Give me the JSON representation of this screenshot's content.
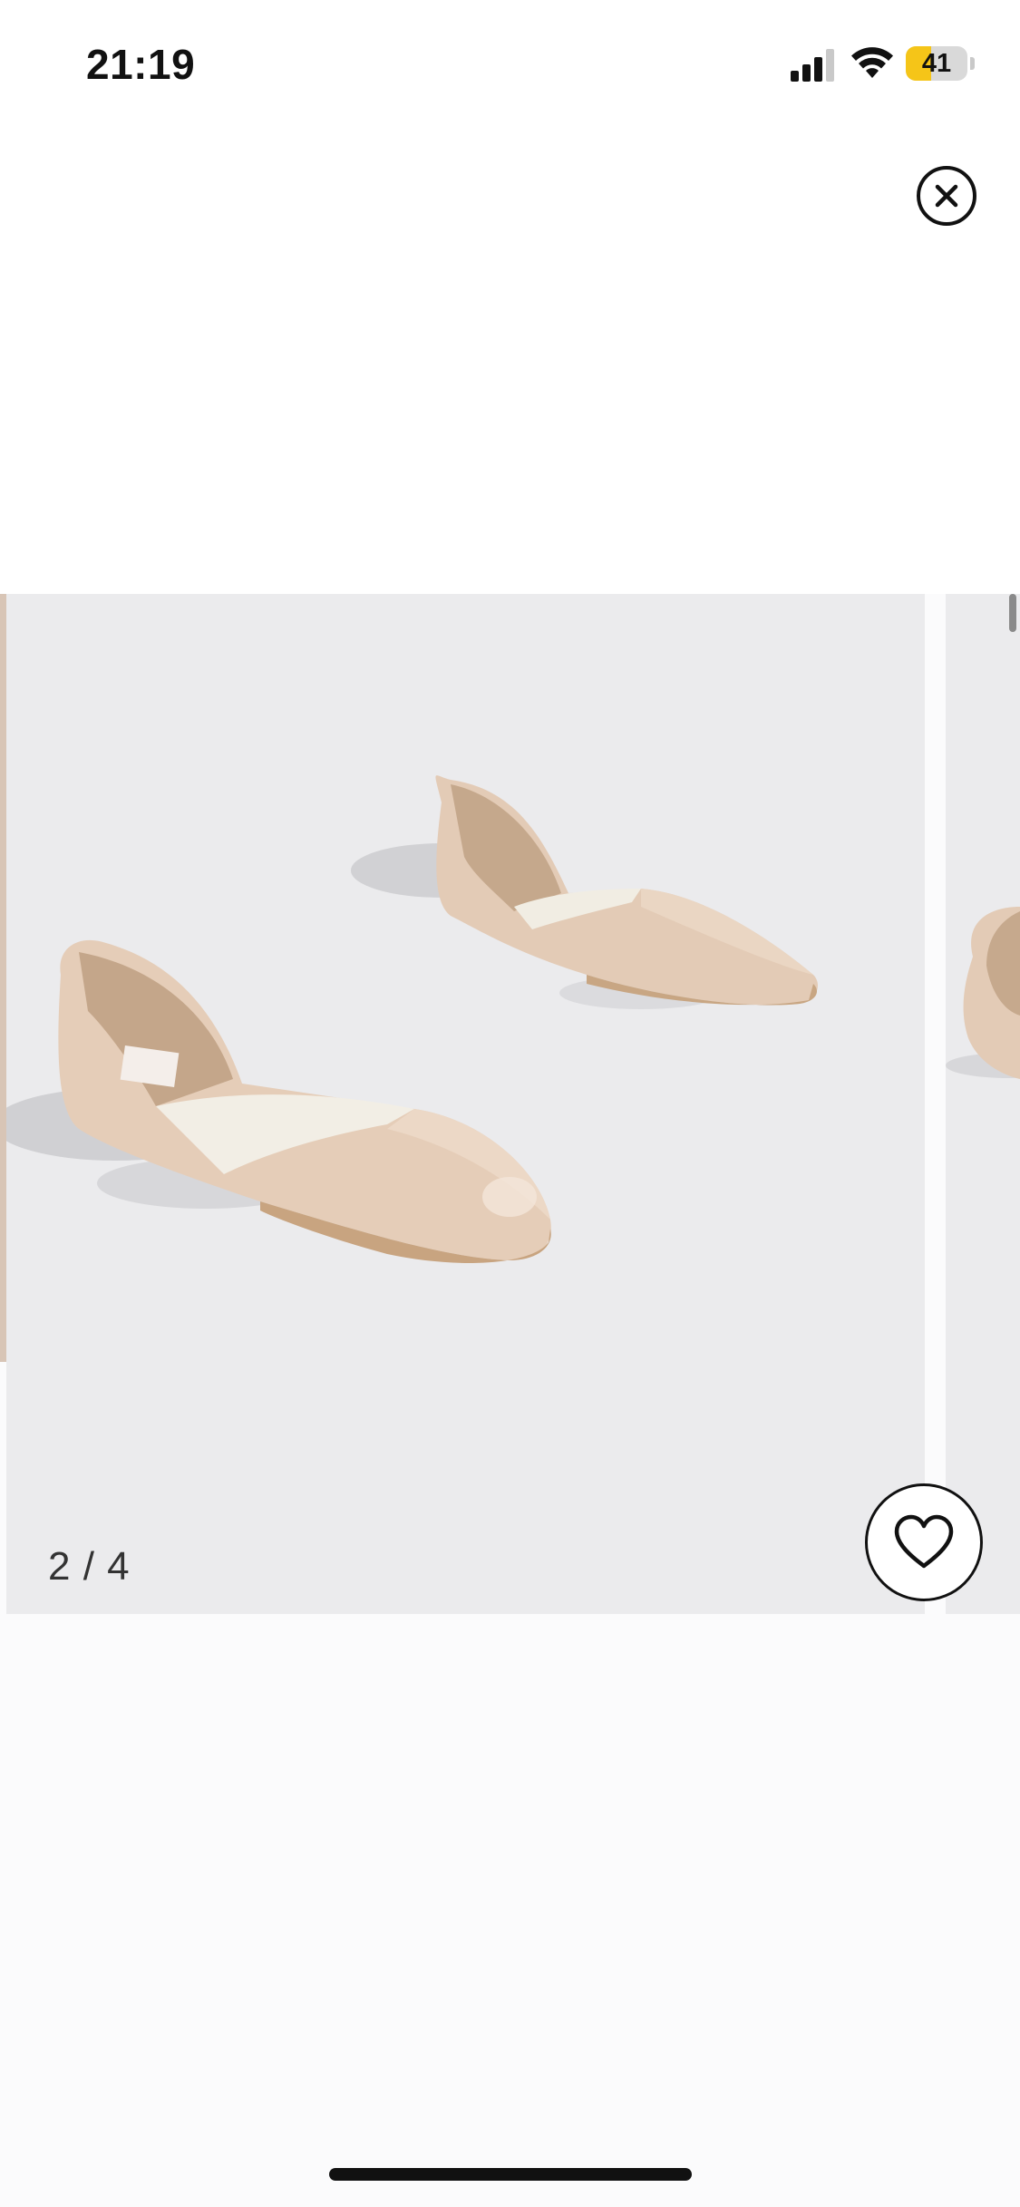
{
  "status_bar": {
    "time": "21:19",
    "battery_level": 41,
    "battery_label": "41",
    "signal_icon": "cellular-signal-icon",
    "wifi_icon": "wifi-icon",
    "battery_color": "#f5c518"
  },
  "header": {
    "close_icon": "close-icon"
  },
  "gallery": {
    "slide_counter": "2 / 4",
    "current_slide": 2,
    "total_slides": 4,
    "background_color": "#ebebed",
    "product_color": "#e4cdb9"
  },
  "actions": {
    "wishlist_icon": "heart-icon"
  }
}
